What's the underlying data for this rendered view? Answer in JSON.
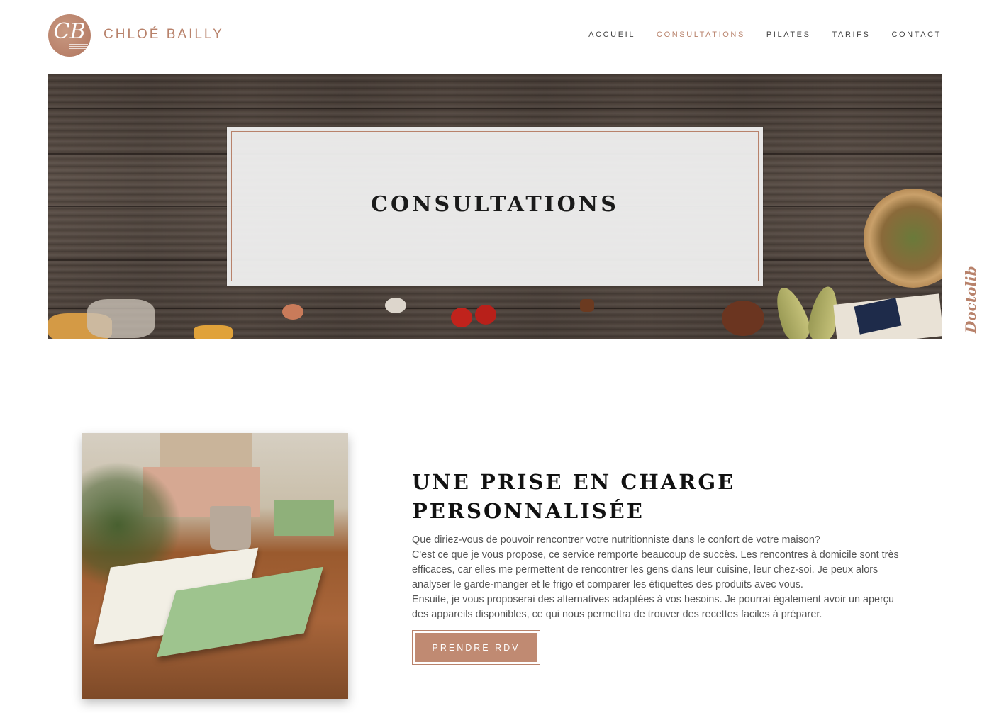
{
  "header": {
    "brand_name": "CHLOÉ BAILLY",
    "logo_initials": "CB"
  },
  "nav": {
    "items": [
      {
        "label": "ACCUEIL",
        "active": false
      },
      {
        "label": "CONSULTATIONS",
        "active": true
      },
      {
        "label": "PILATES",
        "active": false
      },
      {
        "label": "TARIFS",
        "active": false
      },
      {
        "label": "CONTACT",
        "active": false
      }
    ]
  },
  "hero": {
    "title": "CONSULTATIONS"
  },
  "side_tab": {
    "label": "Doctolib"
  },
  "section": {
    "title_line1": "UNE PRISE EN CHARGE",
    "title_line2": "PERSONNALISÉE",
    "paragraphs": [
      "Que diriez-vous de pouvoir rencontrer votre nutritionniste dans le confort de votre maison?",
      "C'est ce que je vous propose, ce service remporte beaucoup de succès. Les rencontres à domicile sont très efficaces, car elles me permettent de rencontrer les gens dans leur cuisine, leur chez-soi. Je peux alors analyser le garde-manger et le frigo et comparer les étiquettes des produits avec vous.",
      "Ensuite, je vous proposerai des alternatives adaptées à vos besoins. Je pourrai également avoir un aperçu des appareils disponibles, ce qui nous permettra de trouver des recettes faciles à préparer."
    ],
    "cta_label": "PRENDRE RDV"
  },
  "colors": {
    "accent": "#b8826b",
    "button": "#c08a72",
    "text": "#555555",
    "heading": "#111111"
  }
}
